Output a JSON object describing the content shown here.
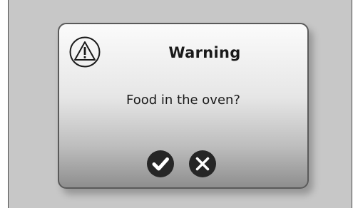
{
  "dialog": {
    "title": "Warning",
    "message": "Food in the oven?",
    "icon": "warning-triangle-icon",
    "confirm_icon": "check-icon",
    "cancel_icon": "close-icon"
  },
  "colors": {
    "screen_background": "#c7c7c7",
    "dialog_border": "#5a5a5a",
    "button_fill": "#262626",
    "button_glyph": "#ffffff"
  }
}
